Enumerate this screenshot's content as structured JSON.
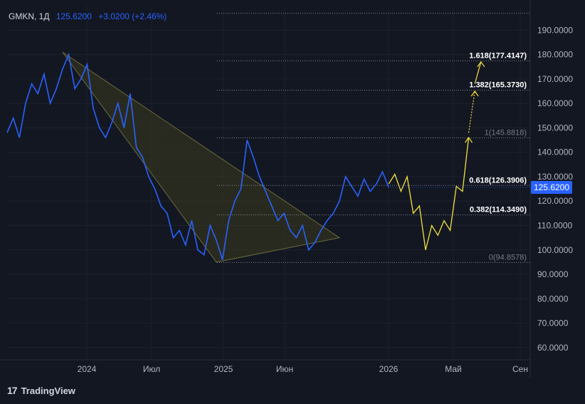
{
  "header": {
    "symbol": "GMKN, 1Д",
    "last_value": "125.6200",
    "change": "+3.0200 (+2.46%)"
  },
  "brand": {
    "name": "TradingView",
    "logo_icon": "tradingview-logo-icon"
  },
  "current_price": {
    "label": "125.6200",
    "value": 125.62,
    "color": "#2962ff"
  },
  "colors": {
    "background": "#131722",
    "series": "#2962ff",
    "projection": "#f5e23a",
    "triangle_fill": "#3a3a1f",
    "grid": "#1e222d",
    "fib_line": "#b2b5be"
  },
  "chart_data": {
    "type": "line",
    "ylim": [
      55,
      200
    ],
    "grid": true,
    "y_ticks": [
      "60.0000",
      "70.0000",
      "80.0000",
      "90.0000",
      "100.0000",
      "110.0000",
      "120.0000",
      "130.0000",
      "140.0000",
      "150.0000",
      "160.0000",
      "170.0000",
      "180.0000",
      "190.0000"
    ],
    "x_ticks": [
      "2024",
      "Июл",
      "2025",
      "Июн",
      "2026",
      "Май",
      "Сен"
    ],
    "series": [
      {
        "values": [
          [
            0,
            148
          ],
          [
            1,
            154
          ],
          [
            2,
            146
          ],
          [
            3,
            160
          ],
          [
            4,
            168
          ],
          [
            5,
            164
          ],
          [
            6,
            172
          ],
          [
            7,
            160
          ],
          [
            8,
            166
          ],
          [
            9,
            174
          ],
          [
            10,
            180
          ],
          [
            11,
            166
          ],
          [
            12,
            170
          ],
          [
            13,
            176
          ],
          [
            14,
            158
          ],
          [
            15,
            150
          ],
          [
            16,
            146
          ],
          [
            17,
            152
          ],
          [
            18,
            160
          ],
          [
            19,
            150
          ],
          [
            20,
            164
          ],
          [
            21,
            142
          ],
          [
            22,
            138
          ],
          [
            23,
            130
          ],
          [
            24,
            125
          ],
          [
            25,
            118
          ],
          [
            26,
            115
          ],
          [
            27,
            105
          ],
          [
            28,
            108
          ],
          [
            29,
            102
          ],
          [
            30,
            112
          ],
          [
            31,
            100
          ],
          [
            32,
            98
          ],
          [
            33,
            110
          ],
          [
            34,
            104
          ],
          [
            35,
            96
          ],
          [
            36,
            112
          ],
          [
            37,
            120
          ],
          [
            38,
            125
          ],
          [
            39,
            145
          ],
          [
            40,
            138
          ],
          [
            41,
            130
          ],
          [
            42,
            124
          ],
          [
            43,
            118
          ],
          [
            44,
            112
          ],
          [
            45,
            115
          ],
          [
            46,
            108
          ],
          [
            47,
            105
          ],
          [
            48,
            110
          ],
          [
            49,
            100
          ],
          [
            50,
            103
          ],
          [
            51,
            108
          ],
          [
            52,
            112
          ],
          [
            53,
            115
          ],
          [
            54,
            120
          ],
          [
            55,
            130
          ],
          [
            56,
            126
          ],
          [
            57,
            122
          ],
          [
            58,
            129
          ],
          [
            59,
            124
          ],
          [
            60,
            127
          ],
          [
            61,
            132
          ],
          [
            62,
            125.62
          ]
        ]
      }
    ],
    "projection_path": [
      [
        62,
        127
      ],
      [
        63,
        131
      ],
      [
        64,
        124
      ],
      [
        65,
        130
      ],
      [
        66,
        115
      ],
      [
        67,
        118
      ],
      [
        68,
        100
      ],
      [
        69,
        110
      ],
      [
        70,
        106
      ],
      [
        71,
        112
      ],
      [
        72,
        108
      ],
      [
        73,
        126
      ],
      [
        74,
        124
      ],
      [
        75,
        146
      ]
    ],
    "projection_arrows": [
      [
        75,
        148,
        76,
        165
      ],
      [
        76,
        168,
        77,
        177
      ]
    ],
    "triangle": [
      [
        9,
        181
      ],
      [
        34,
        95
      ],
      [
        54,
        105
      ]
    ],
    "fibonacci": [
      {
        "ratio": "0",
        "price": 94.8578,
        "label": "0(94.8578)",
        "bold": false
      },
      {
        "ratio": "0.382",
        "price": 114.349,
        "label": "0.382(114.3490)",
        "bold": true
      },
      {
        "ratio": "0.618",
        "price": 126.3906,
        "label": "0.618(126.3906)",
        "bold": true
      },
      {
        "ratio": "1",
        "price": 145.8818,
        "label": "1(145.8818)",
        "bold": false
      },
      {
        "ratio": "1.382",
        "price": 165.373,
        "label": "1.382(165.3730)",
        "bold": true
      },
      {
        "ratio": "1.618",
        "price": 177.4147,
        "label": "1.618(177.4147)",
        "bold": true
      },
      {
        "ratio": "2",
        "price": 196.906,
        "label": "",
        "bold": false
      }
    ]
  }
}
